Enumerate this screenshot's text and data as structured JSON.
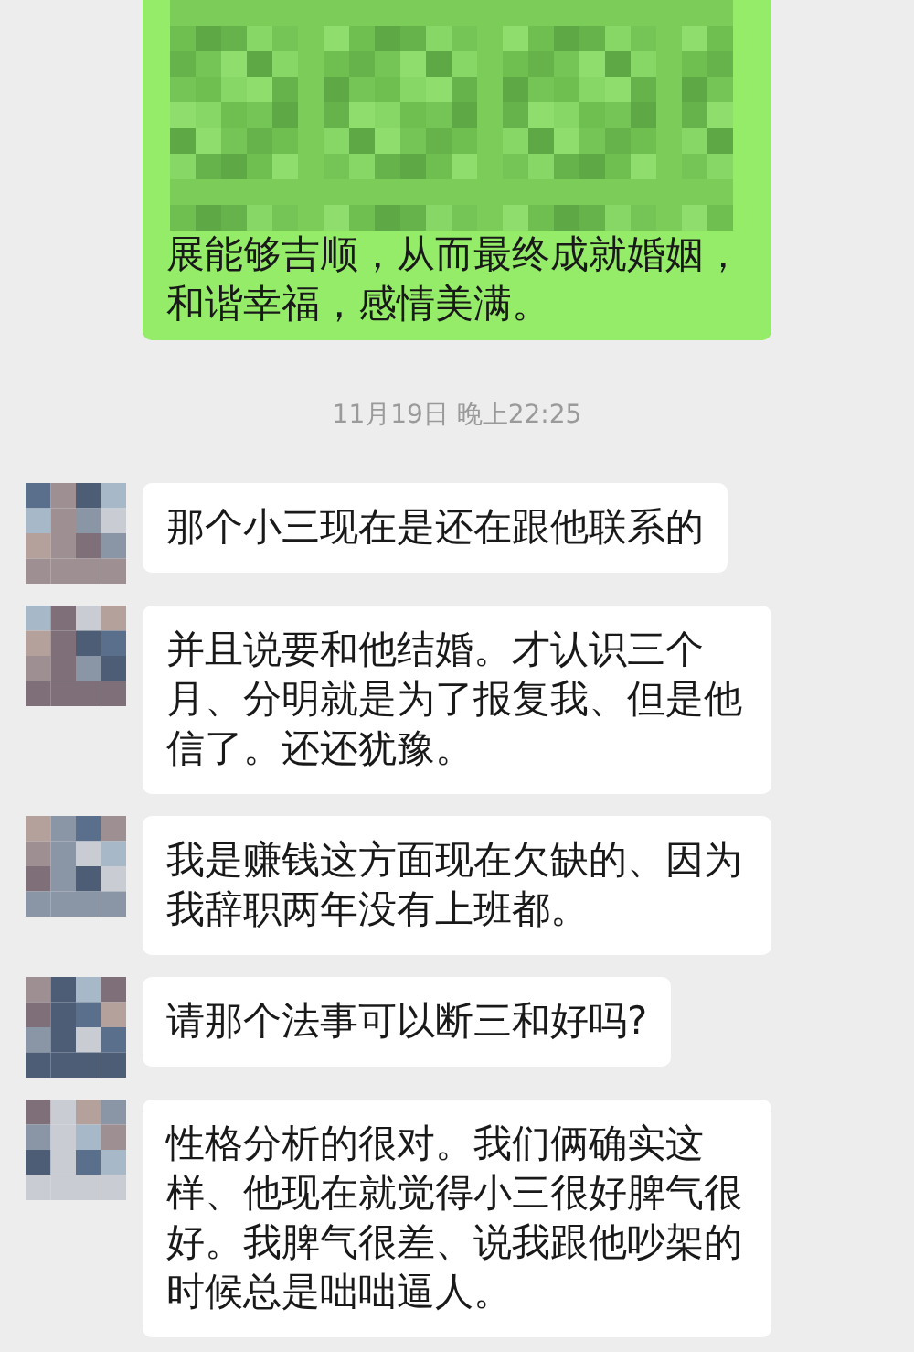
{
  "top_message": {
    "redacted": true,
    "text": "展能够吉顺，从而最终成就婚姻，和谐幸福，感情美满。"
  },
  "timestamp": "11月19日 晚上22:25",
  "messages": [
    {
      "text": "那个小三现在是还在跟他联系的"
    },
    {
      "text": "并且说要和他结婚。才认识三个月、分明就是为了报复我、但是他信了。还还犹豫。"
    },
    {
      "text": "我是赚钱这方面现在欠缺的、因为我辞职两年没有上班都。"
    },
    {
      "text": "请那个法事可以断三和好吗?"
    },
    {
      "text": "性格分析的很对。我们俩确实这样、他现在就觉得小三很好脾气很好。我脾气很差、说我跟他吵架的时候总是咄咄逼人。"
    }
  ]
}
